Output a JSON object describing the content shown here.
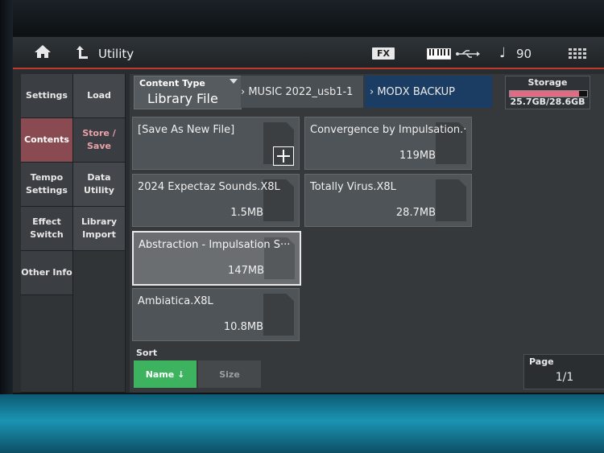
{
  "titlebar": {
    "title": "Utility",
    "fx_badge": "FX",
    "tempo_symbol": "♩",
    "tempo": "90"
  },
  "left_tabs": [
    {
      "label": "Settings"
    },
    {
      "label": "Contents"
    },
    {
      "label": "Tempo Settings"
    },
    {
      "label": "Effect Switch"
    },
    {
      "label": "Other Info"
    }
  ],
  "sub_tabs": [
    {
      "label": "Load"
    },
    {
      "label": "Store / Save"
    },
    {
      "label": "Data Utility"
    },
    {
      "label": "Library Import"
    }
  ],
  "content_type": {
    "label": "Content Type",
    "value": "Library File"
  },
  "path": {
    "segment1": "› MUSIC 2022_usb1-1",
    "segment2": "› MODX BACKUP"
  },
  "storage": {
    "label": "Storage",
    "value": "25.7GB/28.6GB",
    "used_fraction": 0.9
  },
  "files": [
    {
      "name": "[Save As New File]",
      "size": ""
    },
    {
      "name": "Convergence by Impulsation.···",
      "size": "119MB"
    },
    {
      "name": "2024 Expectaz Sounds.X8L",
      "size": "1.5MB"
    },
    {
      "name": "Totally Virus.X8L",
      "size": "28.7MB"
    },
    {
      "name": "Abstraction - Impulsation S···",
      "size": "147MB"
    },
    {
      "name": "Ambiatica.X8L",
      "size": "10.8MB"
    }
  ],
  "sort": {
    "label": "Sort",
    "name_button": "Name ↓",
    "size_button": "Size"
  },
  "page": {
    "label": "Page",
    "value": "1/1"
  },
  "colors": {
    "accent_red": "#c0392b",
    "active_tab": "#8a4a52",
    "sort_active": "#3db35f",
    "path_active": "#1c3d63"
  }
}
